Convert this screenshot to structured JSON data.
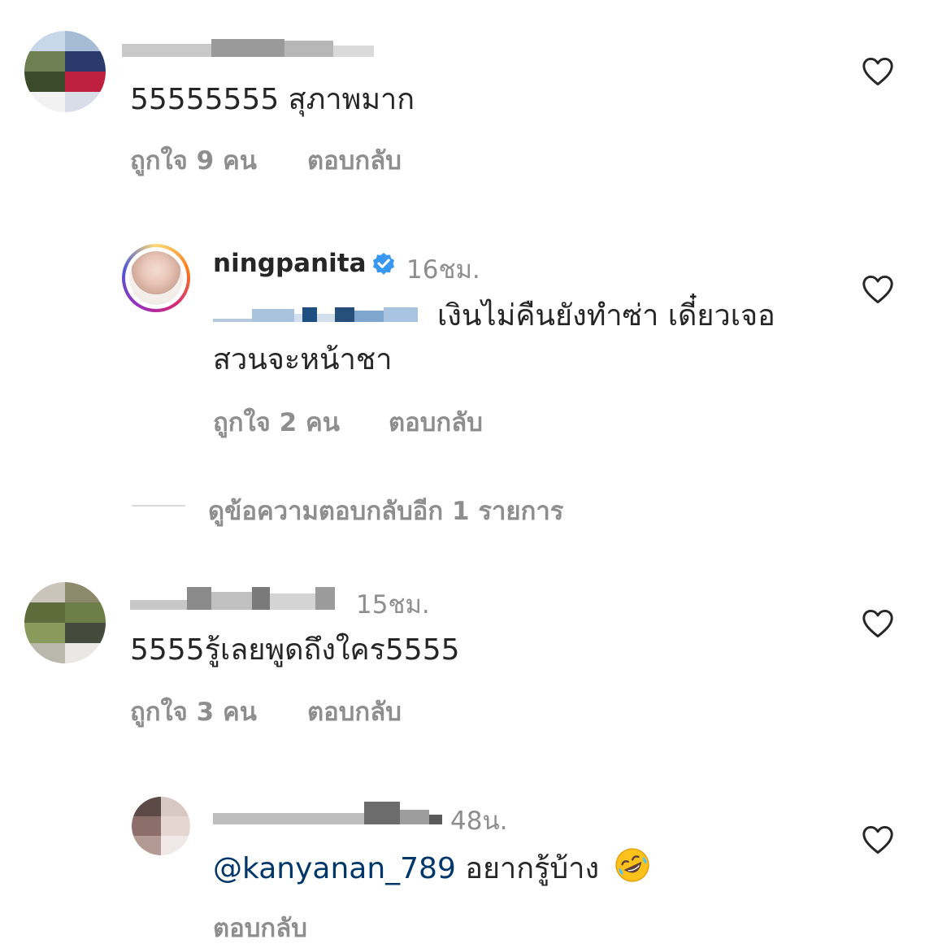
{
  "comments": [
    {
      "username": "",
      "time": "",
      "text": "55555555  สุภาพมาก",
      "likes": "ถูกใจ 9 คน",
      "reply": "ตอบกลับ"
    },
    {
      "username": "ningpanita",
      "verified": true,
      "time": "16ชม.",
      "text_line1": "เงินไม่คืนยังทำซ่า เดี๋ยวเจอ",
      "text_line2": "สวนจะหน้าชา",
      "likes": "ถูกใจ 2 คน",
      "reply": "ตอบกลับ"
    },
    {
      "username": "",
      "time": "15ชม.",
      "text": "5555รู้เลยพูดถึงใคร5555",
      "likes": "ถูกใจ 3 คน",
      "reply": "ตอบกลับ"
    },
    {
      "username": "",
      "time": "48น.",
      "mention": "@kanyanan_789",
      "text": " อยากรู้บ้าง",
      "emoji": "rolling-on-floor-laughing-emoji",
      "reply": "ตอบกลับ"
    }
  ],
  "view_replies": "ดูข้อความตอบกลับอีก 1 รายการ",
  "icons": {
    "heart": "heart-outline-icon",
    "verified": "verified-badge-icon"
  },
  "colors": {
    "text": "#262626",
    "secondary": "#8e8e8e",
    "mention": "#00376b",
    "verified": "#3897f0"
  }
}
